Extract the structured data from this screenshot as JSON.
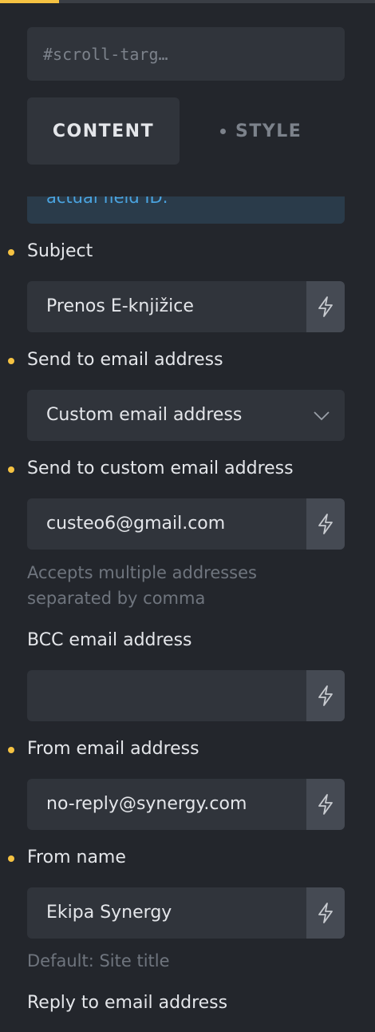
{
  "id_field": {
    "value": "#scroll-targ…"
  },
  "tabs": [
    {
      "label": "CONTENT",
      "active": true
    },
    {
      "label": "STYLE",
      "active": false
    }
  ],
  "notice": {
    "text": "actual field ID."
  },
  "fields": {
    "subject": {
      "label": "Subject",
      "value": "Prenos E-knjižice"
    },
    "send_to": {
      "label": "Send to email address",
      "value": "Custom email address"
    },
    "custom_email": {
      "label": "Send to custom email address",
      "value": "custeo6@gmail.com",
      "help_line1": "Accepts multiple addresses",
      "help_line2": "separated by comma"
    },
    "bcc": {
      "label": "BCC email address",
      "value": ""
    },
    "from_email": {
      "label": "From email address",
      "value": "no-reply@synergy.com"
    },
    "from_name": {
      "label": "From name",
      "value": "Ekipa Synergy",
      "help": "Default: Site title"
    },
    "reply_to": {
      "label": "Reply to email address"
    }
  },
  "icons": {
    "dynamic_data": "bolt-icon",
    "select": "chevron-down-icon"
  },
  "colors": {
    "accent": "#f5c242",
    "background": "#23262c",
    "control": "#30343b",
    "link": "#4aa3df"
  }
}
